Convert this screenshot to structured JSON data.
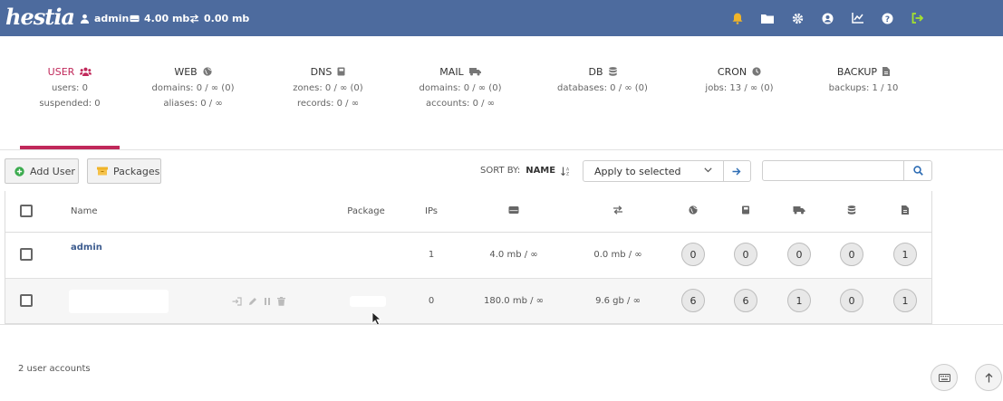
{
  "topbar": {
    "logo": "hestia",
    "user": "admin",
    "disk": "4.00 mb",
    "bandwidth": "0.00 mb",
    "icons": [
      "bell-icon",
      "folder-icon",
      "gear-icon",
      "user-circle-icon",
      "chart-icon",
      "help-icon",
      "logout-icon"
    ],
    "accent": "#4d6b9e",
    "bell_color": "#f0b429",
    "logout_color": "#a6e22e"
  },
  "tabs": [
    {
      "title": "USER",
      "icon": "users-icon",
      "lines": [
        "users: 0",
        "suspended: 0"
      ]
    },
    {
      "title": "WEB",
      "icon": "globe-icon",
      "lines": [
        "domains: 0 / ∞ (0)",
        "aliases: 0 / ∞"
      ]
    },
    {
      "title": "DNS",
      "icon": "book-icon",
      "lines": [
        "zones: 0 / ∞ (0)",
        "records: 0 / ∞"
      ]
    },
    {
      "title": "MAIL",
      "icon": "mail-truck-icon",
      "lines": [
        "domains: 0 / ∞ (0)",
        "accounts: 0 / ∞"
      ]
    },
    {
      "title": "DB",
      "icon": "database-icon",
      "lines": [
        "databases: 0 / ∞ (0)"
      ]
    },
    {
      "title": "CRON",
      "icon": "clock-icon",
      "lines": [
        "jobs: 13 / ∞ (0)"
      ]
    },
    {
      "title": "BACKUP",
      "icon": "file-icon",
      "lines": [
        "backups: 1 / 10"
      ]
    }
  ],
  "active_color": "#c0285a",
  "toolbar": {
    "add_user": "Add User",
    "packages": "Packages",
    "sort_label": "SORT BY:",
    "sort_value": "NAME",
    "select_value": "Apply to selected"
  },
  "table": {
    "headers": {
      "name": "Name",
      "package": "Package",
      "ips": "IPs"
    },
    "rows": [
      {
        "name": "admin",
        "package": "",
        "ips": "1",
        "disk": "4.0 mb / ∞",
        "bandwidth": "0.0 mb / ∞",
        "web": "0",
        "dns": "0",
        "mail": "0",
        "db": "0",
        "backup": "1"
      },
      {
        "name": "",
        "package": "",
        "ips": "0",
        "disk": "180.0 mb / ∞",
        "bandwidth": "9.6 gb / ∞",
        "web": "6",
        "dns": "6",
        "mail": "1",
        "db": "0",
        "backup": "1"
      }
    ]
  },
  "footer": {
    "count": "2 user accounts"
  }
}
